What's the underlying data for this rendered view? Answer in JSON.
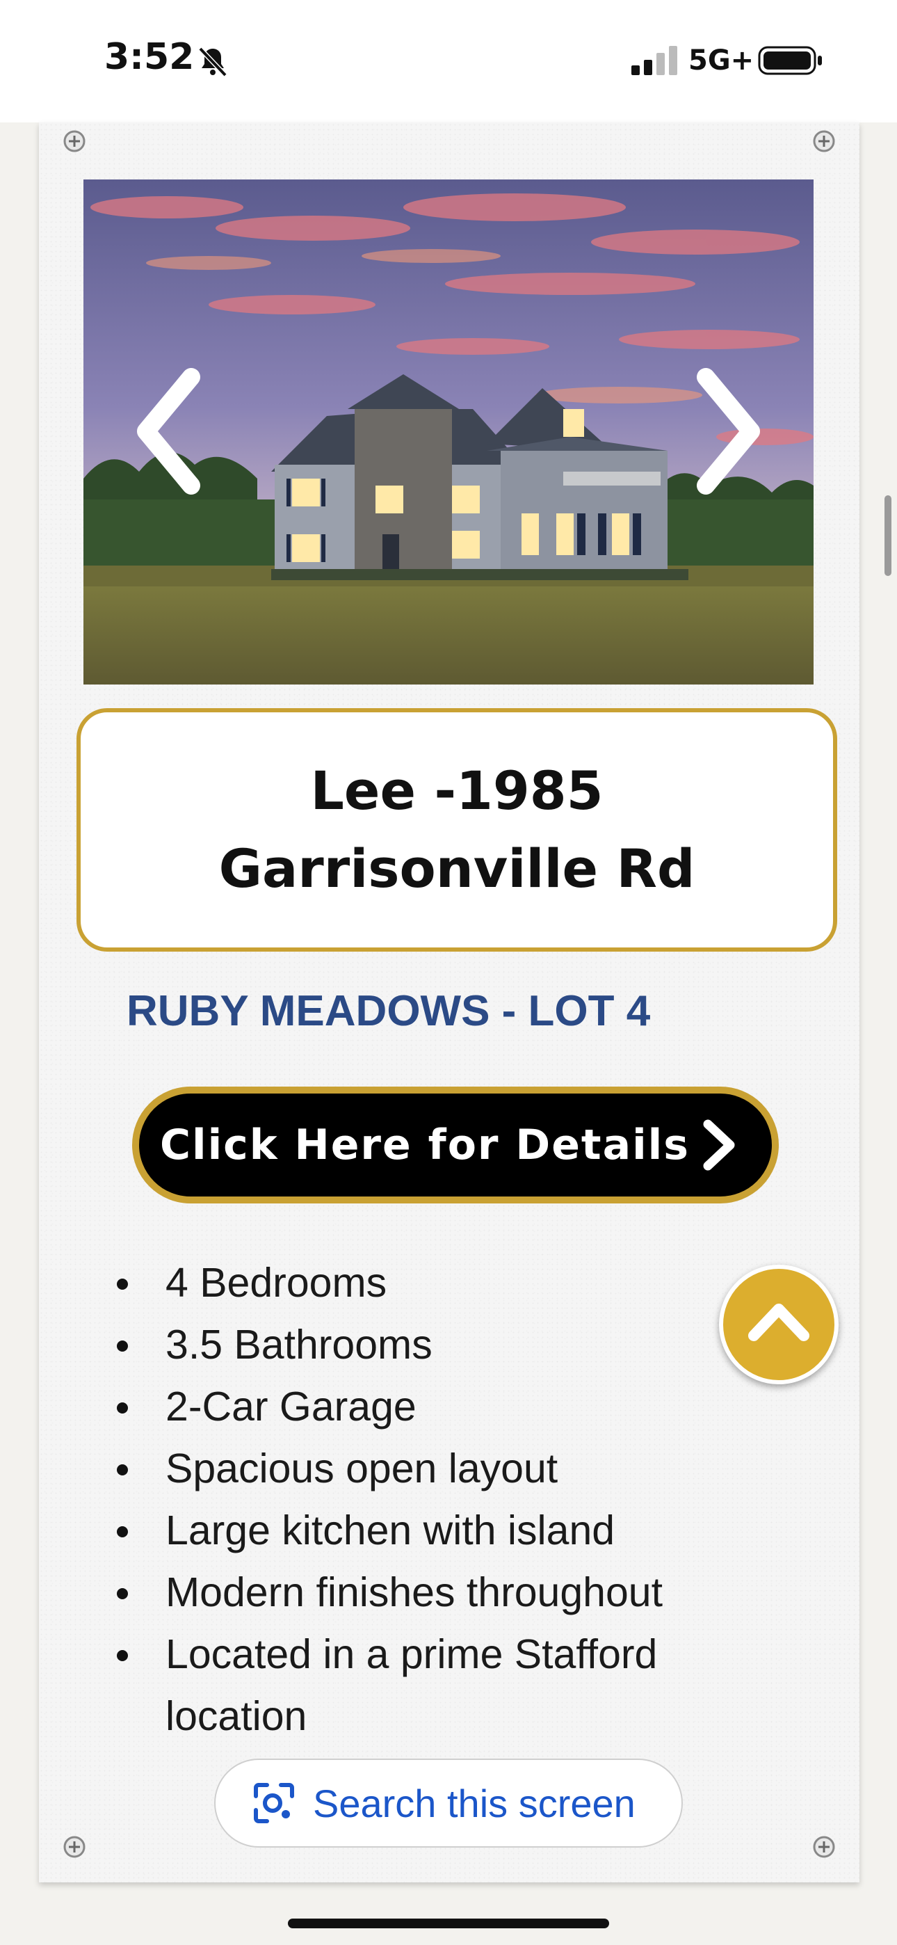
{
  "status_bar": {
    "time": "3:52",
    "network": "5G+",
    "silent_icon": "bell-slash-icon",
    "signal_icon": "cellular-signal-icon",
    "battery_icon": "battery-icon"
  },
  "listing": {
    "image_alt": "Two-story stone and siding house at sunset",
    "title": "Lee -1985 Garrisonville Rd",
    "community": "RUBY MEADOWS - LOT 4",
    "details_button": "Click Here for Details",
    "features": [
      "4 Bedrooms",
      "3.5 Bathrooms",
      "2-Car Garage",
      "Spacious open layout",
      "Large kitchen with island",
      "Modern finishes throughout",
      "Located in a prime Stafford location"
    ]
  },
  "carousel": {
    "prev_icon": "chevron-left-icon",
    "next_icon": "chevron-right-icon"
  },
  "overlay": {
    "search_label": "Search this screen",
    "scroll_top_icon": "chevron-up-icon"
  },
  "colors": {
    "accent_gold": "#c9a133",
    "community_blue": "#2b4a86",
    "search_blue": "#1b56c9"
  }
}
